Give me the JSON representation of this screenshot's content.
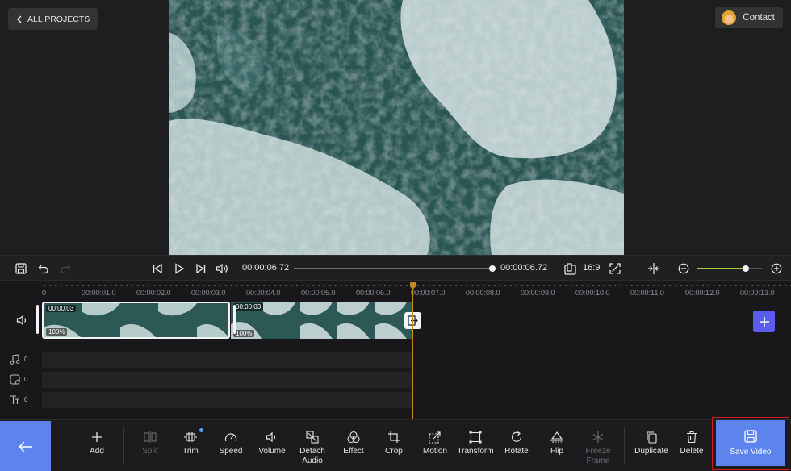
{
  "header": {
    "back_label": "ALL PROJECTS",
    "contact_label": "Contact"
  },
  "playback": {
    "current_time": "00:00:06.72",
    "total_time": "00:00:06.72",
    "aspect_ratio": "16:9",
    "progress_fraction": 1.0,
    "zoom_fraction": 0.75
  },
  "ruler": {
    "ticks": [
      "0",
      "00:00:01.0",
      "00:00:02.0",
      "00:00:03.0",
      "00:00:04.0",
      "00:00:05.0",
      "00:00:06.0",
      "00:00:07.0",
      "00:00:08.0",
      "00:00:09.0",
      "00:00:10.0",
      "00:00:11.0",
      "00:00:12.0",
      "00:00:13.0"
    ]
  },
  "clips": [
    {
      "duration": "00:00:03",
      "volume": "100%"
    },
    {
      "duration": "00:00:03",
      "volume": "100%"
    }
  ],
  "tracks": {
    "music_count": "0",
    "sticker_count": "0",
    "text_count": "0"
  },
  "tools": {
    "add": "Add",
    "split": "Split",
    "trim": "Trim",
    "speed": "Speed",
    "volume": "Volume",
    "detach_audio_1": "Detach",
    "detach_audio_2": "Audio",
    "effect": "Effect",
    "crop": "Crop",
    "motion": "Motion",
    "transform": "Transform",
    "rotate": "Rotate",
    "flip": "Flip",
    "freeze_1": "Freeze",
    "freeze_2": "Frame",
    "duplicate": "Duplicate",
    "delete": "Delete",
    "save_video": "Save Video"
  },
  "colors": {
    "accent": "#5d84ec",
    "playhead": "#c48a16",
    "zoom": "#a8d630",
    "highlight": "#d91a1a"
  }
}
